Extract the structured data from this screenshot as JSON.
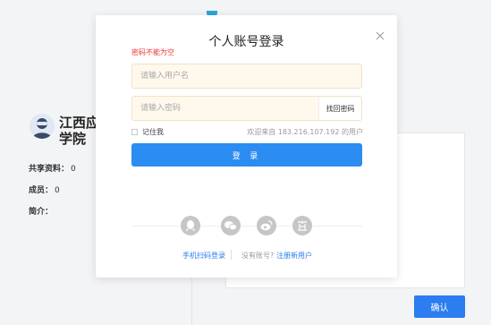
{
  "background": {
    "school_name": "江西应学院",
    "stats": {
      "shared_label": "共享资料：",
      "shared_value": "0",
      "members_label": "成员：",
      "members_value": "0",
      "intro_label": "简介："
    },
    "confirm_label": "确认"
  },
  "login_modal": {
    "title": "个人账号登录",
    "error_message": "密码不能为空",
    "username_placeholder": "请输入用户名",
    "password_placeholder": "请输入密码",
    "find_password_label": "找回密码",
    "remember_label": "记住我",
    "welcome_text": "欢迎来自 183.216.107.192 的用户",
    "login_label": "登 录",
    "social_logins": [
      "qq-icon",
      "wechat-icon",
      "weibo-icon",
      "other-login-icon"
    ],
    "scan_login_label": "手机扫码登录",
    "no_account_text": "没有账号?",
    "register_label": "注册新用户"
  },
  "colors": {
    "primary": "#2b8cf2",
    "error": "#e33333",
    "input_bg": "#fef9ec"
  }
}
